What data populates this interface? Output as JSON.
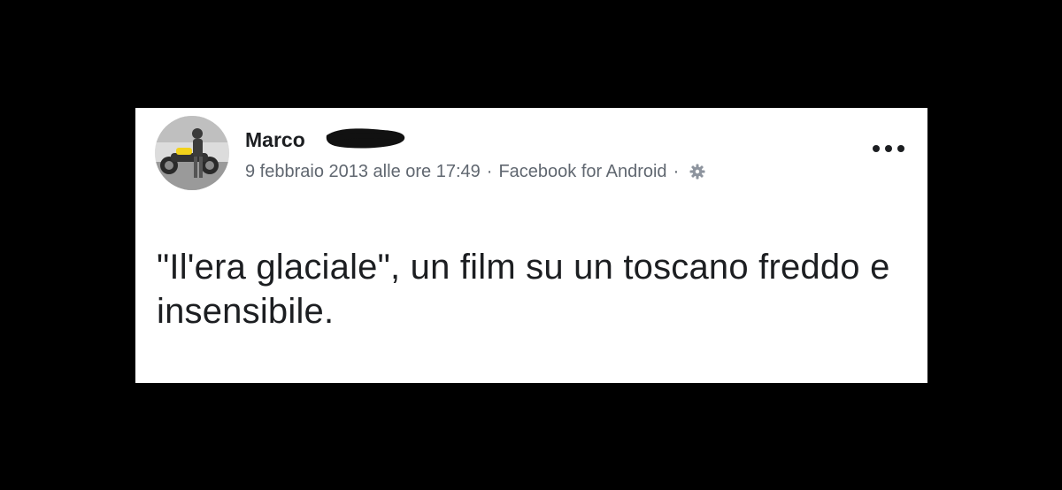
{
  "post": {
    "author_name": "Marco",
    "timestamp": "9 febbraio 2013 alle ore 17:49",
    "separator": "·",
    "source": "Facebook for Android",
    "separator2": "·",
    "privacy_icon": "gear-icon",
    "more_icon": "more-options-icon",
    "text": "\"Il'era glaciale\", un film su un toscano freddo e insensibile."
  },
  "colors": {
    "background": "#000000",
    "card": "#ffffff",
    "name_text": "#1c1e21",
    "meta_text": "#606770",
    "motorbike_accent": "#f2d21b"
  }
}
